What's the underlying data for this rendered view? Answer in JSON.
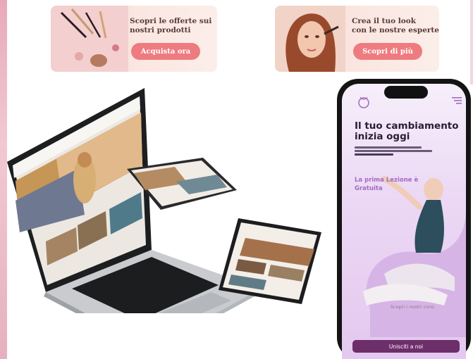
{
  "banners": [
    {
      "text_line1": "Scopri le offerte sui",
      "text_line2": "nostri prodotti",
      "button": "Acquista ora",
      "image_icon": "makeup-brushes-icon"
    },
    {
      "text_line1": "Crea il tuo look",
      "text_line2": "con le nostre esperte",
      "button": "Scopri di più",
      "image_icon": "woman-makeup-photo"
    }
  ],
  "phone": {
    "logo_icon": "lotus-logo-icon",
    "menu_icon": "hamburger-menu-icon",
    "title_line1": "Il tuo cambiamento",
    "title_line2": "inizia oggi",
    "accent_line1": "La prima Lezione è",
    "accent_line2": "Gratuita",
    "courses_text": "Scopri i nostri corsi",
    "cta_button": "Unisciti a noi"
  },
  "colors": {
    "banner_button": "#ee7b7f",
    "phone_cta": "#6c2f6a",
    "phone_accent": "#a36bc0",
    "phone_bg": "#ecd9f5"
  }
}
